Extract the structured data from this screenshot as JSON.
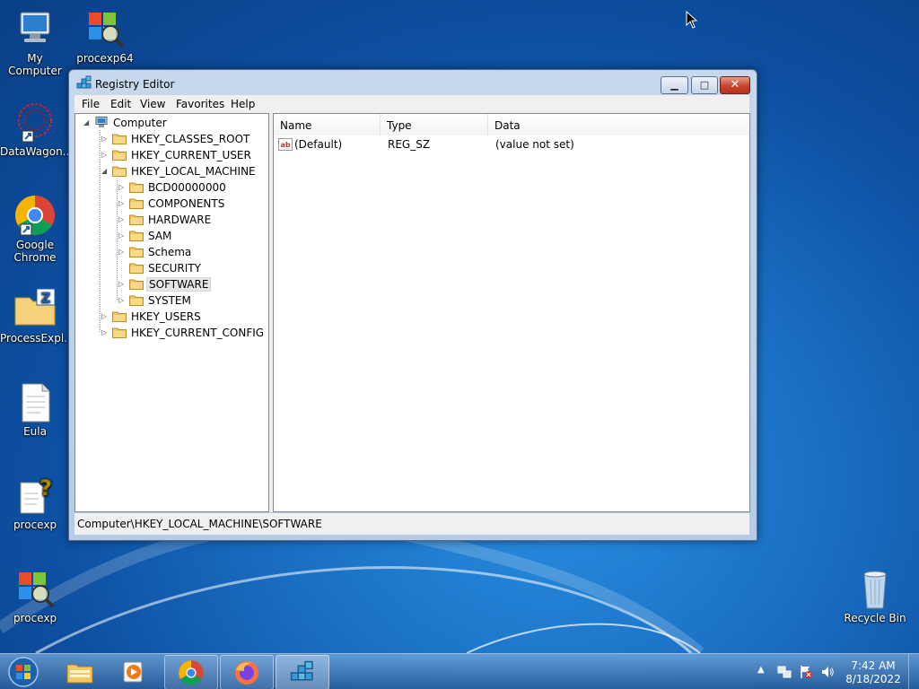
{
  "desktop": {
    "icons": [
      {
        "label": "My Computer",
        "icon": "computer-icon"
      },
      {
        "label": "procexp64",
        "icon": "windows-magnifier-icon"
      },
      {
        "label": "DataWagon...",
        "icon": "datawagon-icon"
      },
      {
        "label": "Google Chrome",
        "icon": "chrome-icon"
      },
      {
        "label": "ProcessExpl...",
        "icon": "zip-folder-icon"
      },
      {
        "label": "Eula",
        "icon": "text-document-icon"
      },
      {
        "label": "procexp",
        "icon": "help-document-icon"
      },
      {
        "label": "procexp",
        "icon": "windows-magnifier-icon"
      },
      {
        "label": "Recycle Bin",
        "icon": "recycle-bin-icon"
      }
    ]
  },
  "window": {
    "title": "Registry Editor",
    "menu": [
      "File",
      "Edit",
      "View",
      "Favorites",
      "Help"
    ],
    "tree": [
      {
        "label": "Computer",
        "level": 0,
        "expander": "expanded"
      },
      {
        "label": "HKEY_CLASSES_ROOT",
        "level": 1,
        "expander": "collapsed"
      },
      {
        "label": "HKEY_CURRENT_USER",
        "level": 1,
        "expander": "collapsed"
      },
      {
        "label": "HKEY_LOCAL_MACHINE",
        "level": 1,
        "expander": "expanded"
      },
      {
        "label": "BCD00000000",
        "level": 2,
        "expander": "collapsed"
      },
      {
        "label": "COMPONENTS",
        "level": 2,
        "expander": "collapsed"
      },
      {
        "label": "HARDWARE",
        "level": 2,
        "expander": "collapsed"
      },
      {
        "label": "SAM",
        "level": 2,
        "expander": "collapsed"
      },
      {
        "label": "Schema",
        "level": 2,
        "expander": "collapsed"
      },
      {
        "label": "SECURITY",
        "level": 2,
        "expander": "none"
      },
      {
        "label": "SOFTWARE",
        "level": 2,
        "expander": "collapsed",
        "selected": true
      },
      {
        "label": "SYSTEM",
        "level": 2,
        "expander": "collapsed"
      },
      {
        "label": "HKEY_USERS",
        "level": 1,
        "expander": "collapsed"
      },
      {
        "label": "HKEY_CURRENT_CONFIG",
        "level": 1,
        "expander": "collapsed"
      }
    ],
    "columns": [
      "Name",
      "Type",
      "Data"
    ],
    "rows": [
      {
        "name": "(Default)",
        "type": "REG_SZ",
        "data": "(value not set)"
      }
    ],
    "status": "Computer\\HKEY_LOCAL_MACHINE\\SOFTWARE"
  },
  "taskbar": {
    "buttons": [
      {
        "icon": "windows-explorer-icon"
      },
      {
        "icon": "media-player-icon"
      },
      {
        "icon": "chrome-icon"
      },
      {
        "icon": "firefox-icon"
      },
      {
        "icon": "registry-editor-icon"
      }
    ],
    "clock": {
      "time": "7:42 AM",
      "date": "8/18/2022"
    }
  }
}
